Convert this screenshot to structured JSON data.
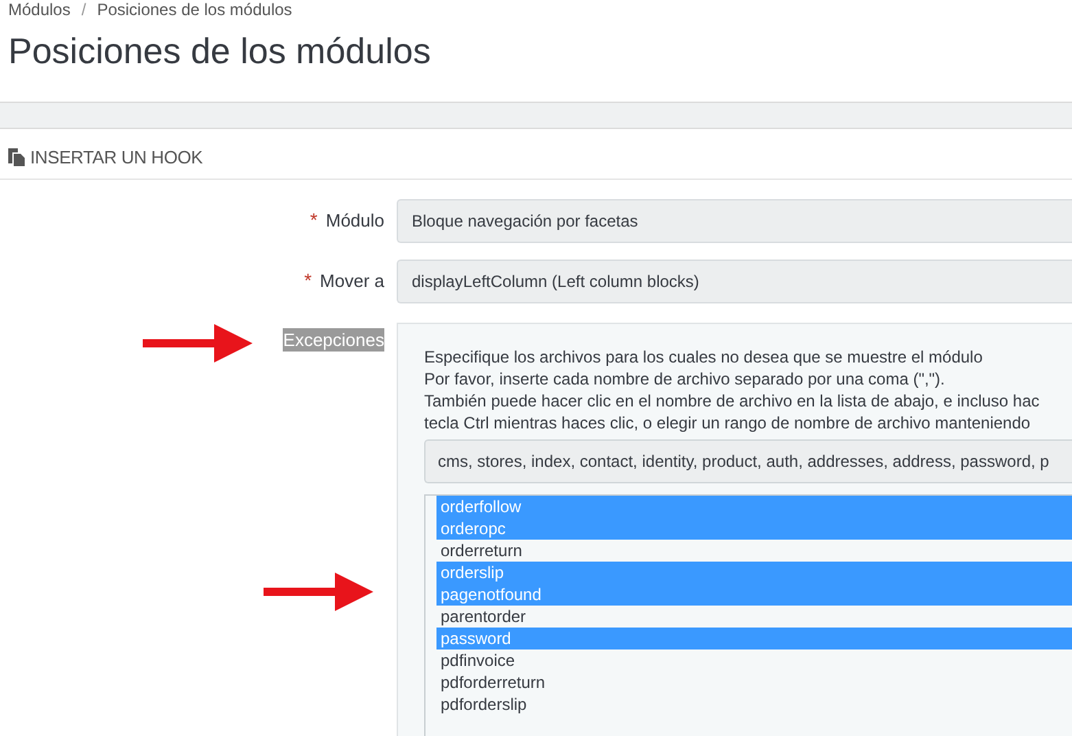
{
  "breadcrumb": {
    "items": [
      "Módulos",
      "Posiciones de los módulos"
    ],
    "separator": "/"
  },
  "page_title": "Posiciones de los módulos",
  "panel": {
    "title": "INSERTAR UN HOOK"
  },
  "form": {
    "fields": [
      {
        "label": "Módulo",
        "required_mark": "*",
        "value": "Bloque navegación por facetas"
      },
      {
        "label": "Mover a",
        "required_mark": "*",
        "value": "displayLeftColumn (Left column blocks)"
      }
    ],
    "exceptions": {
      "label": "Excepciones",
      "highlighted": true,
      "help": [
        "Especifique los archivos para los cuales no desea que se muestre el módulo",
        "Por favor, inserte cada nombre de archivo separado por una coma (\",\").",
        "También puede hacer clic en el nombre de archivo en la lista de abajo, e incluso hac",
        "tecla Ctrl mientras haces clic, o elegir un rango de nombre de archivo manteniendo"
      ],
      "value": "cms, stores, index, contact, identity, product, auth, addresses, address, password, p",
      "files": [
        {
          "name": "orderfollow",
          "selected": true
        },
        {
          "name": "orderopc",
          "selected": true
        },
        {
          "name": "orderreturn",
          "selected": false
        },
        {
          "name": "orderslip",
          "selected": true
        },
        {
          "name": "pagenotfound",
          "selected": true
        },
        {
          "name": "parentorder",
          "selected": false
        },
        {
          "name": "password",
          "selected": true
        },
        {
          "name": "pdfinvoice",
          "selected": false
        },
        {
          "name": "pdforderreturn",
          "selected": false
        },
        {
          "name": "pdforderslip",
          "selected": false
        }
      ]
    }
  }
}
